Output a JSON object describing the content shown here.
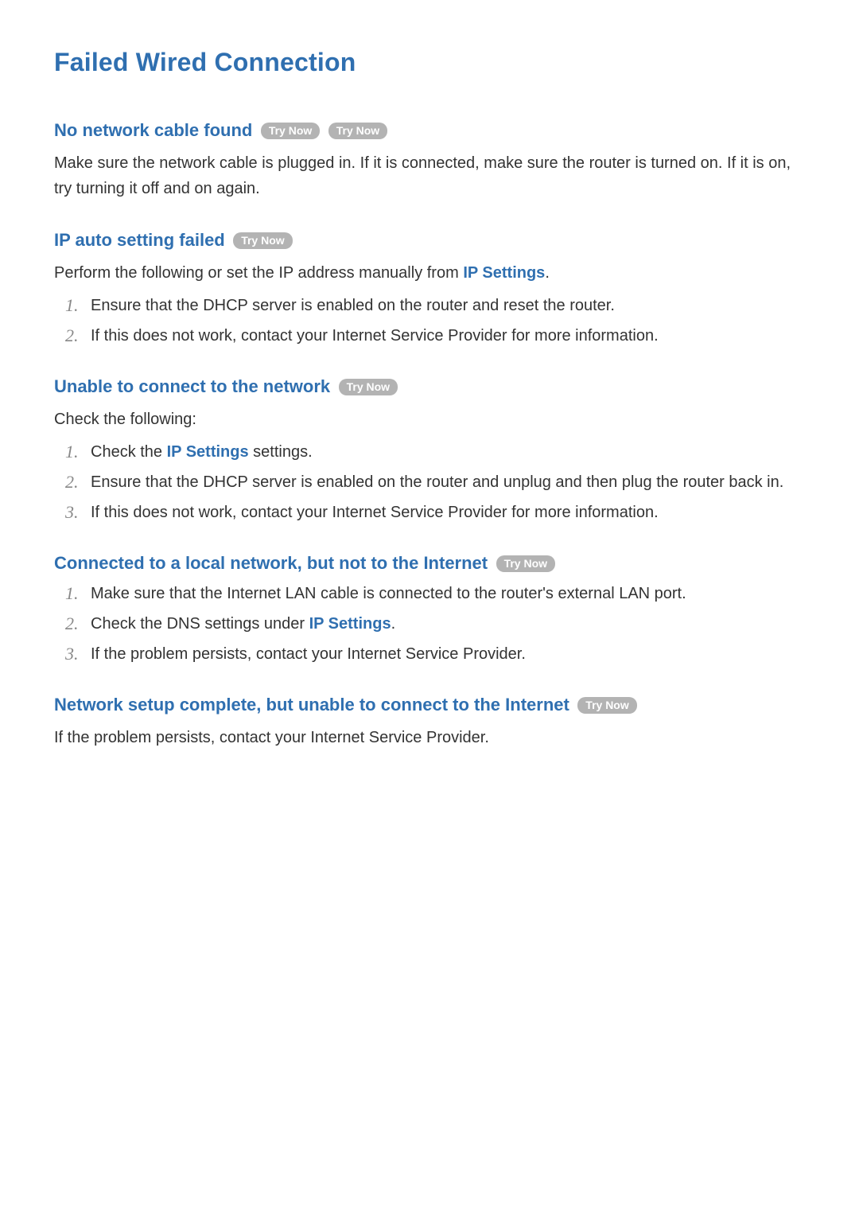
{
  "page_title": "Failed Wired Connection",
  "try_now_label": "Try Now",
  "sections": {
    "no_cable": {
      "title": "No network cable found",
      "body": "Make sure the network cable is plugged in. If it is connected, make sure the router is turned on. If it is on, try turning it off and on again."
    },
    "ip_auto": {
      "title": "IP auto setting failed",
      "intro_pre": "Perform the following or set the IP address manually from ",
      "intro_link": "IP Settings",
      "intro_post": ".",
      "items": [
        "Ensure that the DHCP server is enabled on the router and reset the router.",
        "If this does not work, contact your Internet Service Provider for more information."
      ]
    },
    "unable_connect": {
      "title": "Unable to connect to the network",
      "intro": "Check the following:",
      "item1_pre": "Check the ",
      "item1_link": "IP Settings",
      "item1_post": " settings.",
      "item2": "Ensure that the DHCP server is enabled on the router and unplug and then plug the router back in.",
      "item3": "If this does not work, contact your Internet Service Provider for more information."
    },
    "local_not_internet": {
      "title": "Connected to a local network, but not to the Internet",
      "item1": "Make sure that the Internet LAN cable is connected to the router's external LAN port.",
      "item2_pre": "Check the DNS settings under ",
      "item2_link": "IP Settings",
      "item2_post": ".",
      "item3": "If the problem persists, contact your Internet Service Provider."
    },
    "setup_complete": {
      "title": "Network setup complete, but unable to connect to the Internet",
      "body": "If the problem persists, contact your Internet Service Provider."
    }
  },
  "nums": {
    "n1": "1.",
    "n2": "2.",
    "n3": "3."
  }
}
